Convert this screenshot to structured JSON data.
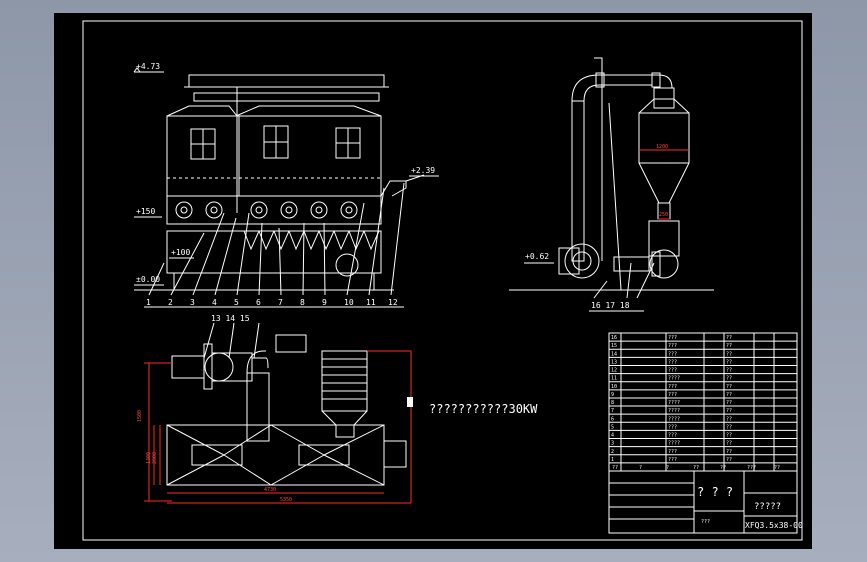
{
  "drawing": {
    "elevation_top": "+4.73",
    "elevation_inlet": "+2.39",
    "elevation_150": "+150",
    "elevation_100": "+100",
    "elevation_ground": "±0.00",
    "elevation_side": "+0.62",
    "part_numbers_front": [
      "1",
      "2",
      "3",
      "4",
      "5",
      "6",
      "7",
      "8",
      "9",
      "10",
      "11",
      "12"
    ],
    "part_numbers_plan": [
      "13",
      "14",
      "15"
    ],
    "part_numbers_side": [
      "16",
      "17",
      "18"
    ],
    "dim_cyclone_dia": "1200",
    "dim_cyclone_outlet": "250",
    "dim_plan_width": "4730",
    "dim_plan_total": "5350",
    "dim_plan_depth": "1500",
    "dim_plan_side_a": "1300",
    "dim_plan_side_b": "2000",
    "note_text": "???????????30KW"
  },
  "title_block": {
    "header_center": "? ? ?",
    "header_right": "?????",
    "drawing_no": "XFQ3.5x38-00",
    "scale_label": "???",
    "bom_row_numbers": [
      "16",
      "15",
      "14",
      "13",
      "12",
      "11",
      "10",
      "9",
      "8",
      "7",
      "6",
      "5",
      "4",
      "3",
      "2",
      "1"
    ],
    "bom_codes": [
      "???",
      "???",
      "???",
      "???",
      "???",
      "????",
      "???",
      "???",
      "????",
      "????",
      "????",
      "???",
      "???",
      "????",
      "???",
      "???"
    ],
    "bom_bottom": [
      "??",
      "?",
      "?",
      "??",
      "??",
      "???",
      "??"
    ]
  },
  "colors": {
    "background": "#000000",
    "lines": "#ffffff",
    "dimensions": "#ff2a2a",
    "frame_outer": "#9aa3b3"
  }
}
